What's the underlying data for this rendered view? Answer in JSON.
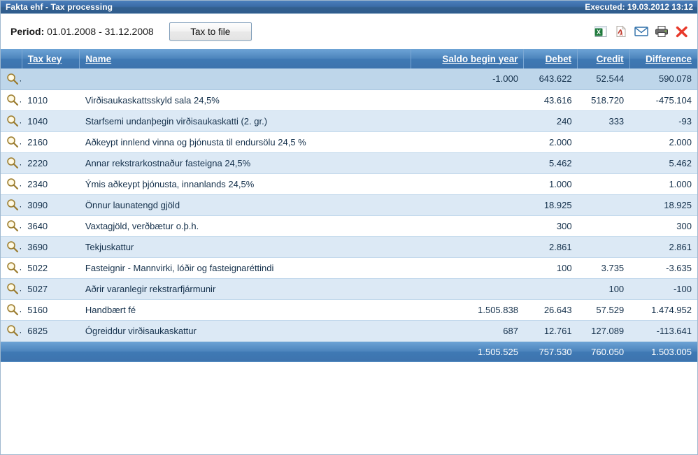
{
  "titlebar": {
    "title": "Fakta ehf - Tax processing",
    "executed": "Executed:  19.03.2012 13:12"
  },
  "toolbar": {
    "period_label": "Period:",
    "period_value": "01.01.2008 - 31.12.2008",
    "tax_to_file_label": "Tax to file",
    "icons": [
      "excel-export-icon",
      "pdf-export-icon",
      "email-icon",
      "print-icon",
      "close-icon"
    ]
  },
  "table": {
    "headers": {
      "icon": "",
      "tax_key": "Tax key",
      "name": "Name",
      "saldo": "Saldo begin year",
      "debet": "Debet",
      "credit": "Credit",
      "difference": "Difference"
    },
    "rows": [
      {
        "key": "",
        "name": "",
        "saldo": "-1.000",
        "debet": "643.622",
        "credit": "52.544",
        "difference": "590.078",
        "summary": true
      },
      {
        "key": "1010",
        "name": "Virðisaukaskattsskyld sala 24,5%",
        "saldo": "",
        "debet": "43.616",
        "credit": "518.720",
        "difference": "-475.104"
      },
      {
        "key": "1040",
        "name": "Starfsemi undanþegin virðisaukaskatti (2. gr.)",
        "saldo": "",
        "debet": "240",
        "credit": "333",
        "difference": "-93"
      },
      {
        "key": "2160",
        "name": "Aðkeypt innlend vinna og þjónusta til endursölu 24,5 %",
        "saldo": "",
        "debet": "2.000",
        "credit": "",
        "difference": "2.000"
      },
      {
        "key": "2220",
        "name": "Annar rekstrarkostnaður fasteigna  24,5%",
        "saldo": "",
        "debet": "5.462",
        "credit": "",
        "difference": "5.462"
      },
      {
        "key": "2340",
        "name": "Ýmis aðkeypt þjónusta, innanlands  24,5%",
        "saldo": "",
        "debet": "1.000",
        "credit": "",
        "difference": "1.000"
      },
      {
        "key": "3090",
        "name": "Önnur launatengd gjöld",
        "saldo": "",
        "debet": "18.925",
        "credit": "",
        "difference": "18.925"
      },
      {
        "key": "3640",
        "name": "Vaxtagjöld, verðbætur o.þ.h.",
        "saldo": "",
        "debet": "300",
        "credit": "",
        "difference": "300"
      },
      {
        "key": "3690",
        "name": "Tekjuskattur",
        "saldo": "",
        "debet": "2.861",
        "credit": "",
        "difference": "2.861"
      },
      {
        "key": "5022",
        "name": "Fasteignir - Mannvirki, lóðir og fasteignaréttindi",
        "saldo": "",
        "debet": "100",
        "credit": "3.735",
        "difference": "-3.635"
      },
      {
        "key": "5027",
        "name": "Aðrir varanlegir rekstrarfjármunir",
        "saldo": "",
        "debet": "",
        "credit": "100",
        "difference": "-100"
      },
      {
        "key": "5160",
        "name": "Handbært fé",
        "saldo": "1.505.838",
        "debet": "26.643",
        "credit": "57.529",
        "difference": "1.474.952"
      },
      {
        "key": "6825",
        "name": "Ógreiddur virðisaukaskattur",
        "saldo": "687",
        "debet": "12.761",
        "credit": "127.089",
        "difference": "-113.641"
      }
    ],
    "totals": {
      "saldo": "1.505.525",
      "debet": "757.530",
      "credit": "760.050",
      "difference": "1.503.005"
    }
  },
  "colors": {
    "header_blue": "#4d85bd",
    "title_blue": "#33608f",
    "row_alt": "#dce9f5",
    "summary_row": "#bed6ea",
    "close_red": "#e8392a"
  }
}
